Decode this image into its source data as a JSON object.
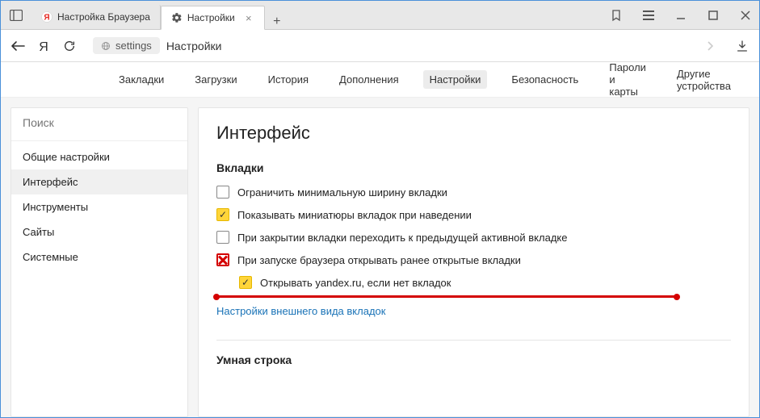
{
  "tabs": [
    {
      "title": "Настройка Браузера",
      "favicon": "yandex"
    },
    {
      "title": "Настройки",
      "favicon": "gear",
      "active": true
    }
  ],
  "addressbar": {
    "chip_label": "settings",
    "page_title": "Настройки"
  },
  "topnav": {
    "items": [
      "Закладки",
      "Загрузки",
      "История",
      "Дополнения",
      "Настройки",
      "Безопасность",
      "Пароли и карты",
      "Другие устройства"
    ],
    "active_index": 4
  },
  "sidebar": {
    "search_placeholder": "Поиск",
    "items": [
      "Общие настройки",
      "Интерфейс",
      "Инструменты",
      "Сайты",
      "Системные"
    ],
    "active_index": 1
  },
  "main": {
    "heading": "Интерфейс",
    "section1_title": "Вкладки",
    "options": [
      {
        "label": "Ограничить минимальную ширину вкладки",
        "checked": false,
        "cross": false
      },
      {
        "label": "Показывать миниатюры вкладок при наведении",
        "checked": true,
        "cross": false
      },
      {
        "label": "При закрытии вкладки переходить к предыдущей активной вкладке",
        "checked": false,
        "cross": false
      },
      {
        "label": "При запуске браузера открывать ранее открытые вкладки",
        "checked": false,
        "cross": true
      },
      {
        "label": "Открывать yandex.ru, если нет вкладок",
        "checked": true,
        "cross": false,
        "sub": true
      }
    ],
    "link_label": "Настройки внешнего вида вкладок",
    "section2_title": "Умная строка"
  }
}
